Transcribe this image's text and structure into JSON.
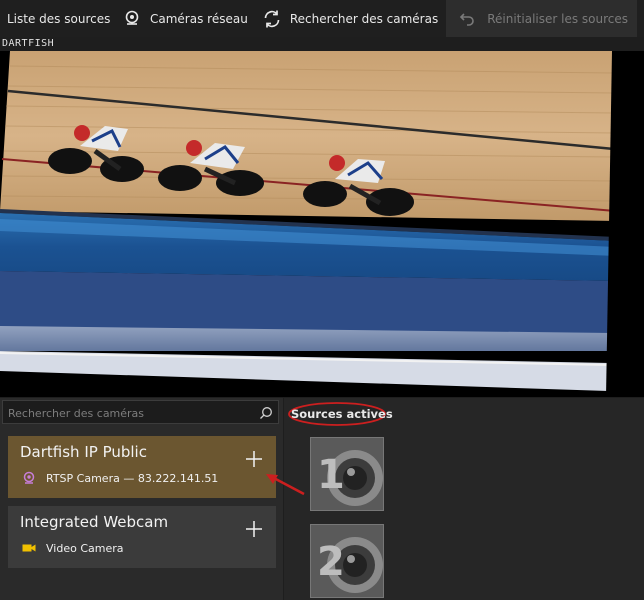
{
  "toolbar": {
    "list_label": "Liste des sources",
    "network_label": "Caméras réseau",
    "search_label": "Rechercher des caméras",
    "reset_label": "Réinitialiser les sources"
  },
  "video": {
    "overlay_label": "DARTFISH"
  },
  "search": {
    "placeholder": "Rechercher des caméras"
  },
  "cameras": [
    {
      "name": "Dartfish IP Public",
      "subtitle": "RTSP Camera — 83.222.141.51",
      "icon": "ip-camera-icon",
      "selected": true
    },
    {
      "name": "Integrated Webcam",
      "subtitle": "Video Camera",
      "icon": "video-camera-icon",
      "selected": false
    }
  ],
  "active_sources": {
    "title": "Sources actives",
    "slots": [
      {
        "number": "1"
      },
      {
        "number": "2"
      }
    ]
  },
  "colors": {
    "selected_card": "#6b5630",
    "annotation_red": "#cc1f1f",
    "ip_icon": "#c77dd7",
    "webcam_icon": "#f0c000"
  }
}
